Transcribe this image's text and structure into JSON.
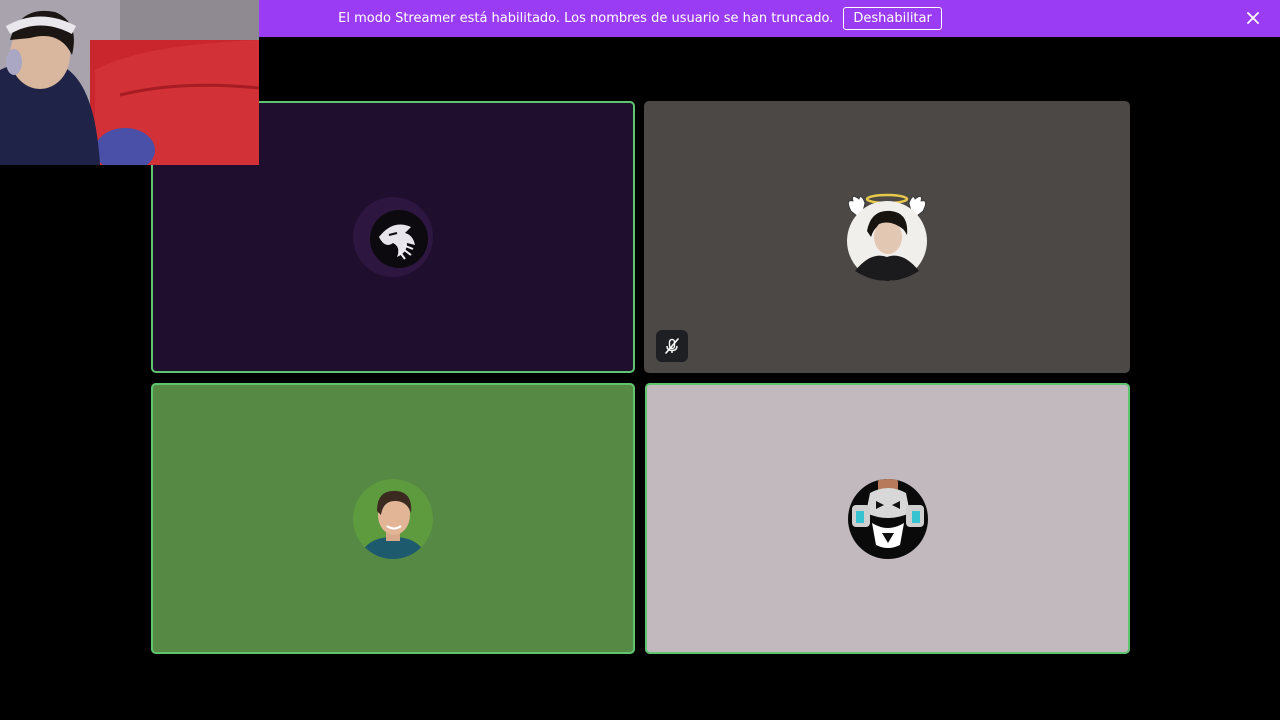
{
  "colors": {
    "banner_bg": "#9b3cf5",
    "speaking_ring": "#5ec46f",
    "tile_1_bg": "#200e2e",
    "tile_2_bg": "#4b4845",
    "tile_3_bg": "#568a44",
    "tile_4_bg": "#c1b9be"
  },
  "banner": {
    "message": "El modo Streamer está habilitado. Los nombres de usuario se han truncado.",
    "disable_label": "Deshabilitar",
    "close_icon": "close-icon"
  },
  "participants": [
    {
      "avatar": "dragon-avatar",
      "speaking": true,
      "muted": false
    },
    {
      "avatar": "angel-boy-avatar",
      "speaking": false,
      "muted": true,
      "mute_icon": "microphone-muted-icon"
    },
    {
      "avatar": "man-portrait-avatar",
      "speaking": true,
      "muted": false
    },
    {
      "avatar": "robot-avatar",
      "speaking": true,
      "muted": false
    }
  ],
  "webcam": {
    "icon": "webcam-feed"
  }
}
